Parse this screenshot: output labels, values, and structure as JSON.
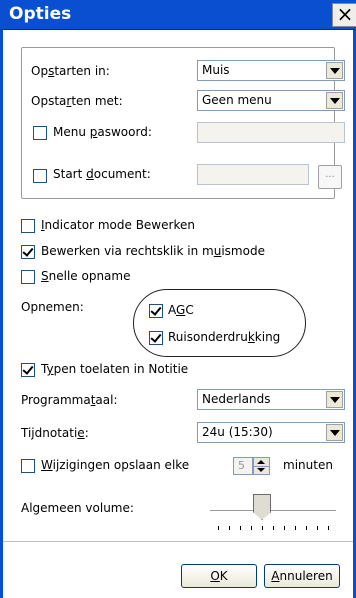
{
  "dialog": {
    "title": "Opties",
    "close_glyph": "×"
  },
  "group": {
    "startup_in": {
      "label_pre": "Op",
      "label_u": "s",
      "label_post": "tarten in:",
      "value": "Muis"
    },
    "startup_with": {
      "label_pre": "Opsta",
      "label_u": "r",
      "label_post": "ten met:",
      "value": "Geen menu"
    },
    "menu_password": {
      "label_pre": "Menu ",
      "label_u": "p",
      "label_post": "aswoord:",
      "checked": false,
      "value": ""
    },
    "start_document": {
      "label_pre": "Start ",
      "label_u": "d",
      "label_post": "ocument:",
      "checked": false,
      "value": "",
      "browse_label": "..."
    }
  },
  "options": {
    "indicator": {
      "label_pre": "",
      "label_u": "I",
      "label_post": "ndicator mode Bewerken",
      "checked": false
    },
    "rightclick": {
      "label_pre": "Bewerken via rechtsklik in m",
      "label_u": "u",
      "label_post": "ismode",
      "checked": true
    },
    "quick_record": {
      "label_pre": "",
      "label_u": "S",
      "label_post": "nelle opname",
      "checked": false
    }
  },
  "recording": {
    "label": "Opnemen:",
    "agc": {
      "label_pre": "A",
      "label_u": "G",
      "label_post": "C",
      "checked": true
    },
    "noise": {
      "label_pre": "Ruisonderdru",
      "label_u": "k",
      "label_post": "king",
      "checked": true
    }
  },
  "typing": {
    "label_pre": "T",
    "label_u": "y",
    "label_post": "pen toelaten in Notitie",
    "checked": true
  },
  "language": {
    "label_pre": "Programma",
    "label_u": "t",
    "label_post": "aal:",
    "value": "Nederlands"
  },
  "time_format": {
    "label_pre": "Tijdnotati",
    "label_u": "e",
    "label_post": ":",
    "value": "24u (15:30)"
  },
  "autosave": {
    "label_pre": "",
    "label_u": "W",
    "label_post": "ijzigingen opslaan elke",
    "checked": false,
    "value": "5",
    "unit": "minuten"
  },
  "volume": {
    "label": "Algemeen volume:",
    "level": 0.4,
    "tick_count": 11
  },
  "buttons": {
    "ok": {
      "label_pre": "",
      "label_u": "O",
      "label_post": "K"
    },
    "cancel": {
      "label_pre": "",
      "label_u": "A",
      "label_post": "nnuleren"
    }
  }
}
